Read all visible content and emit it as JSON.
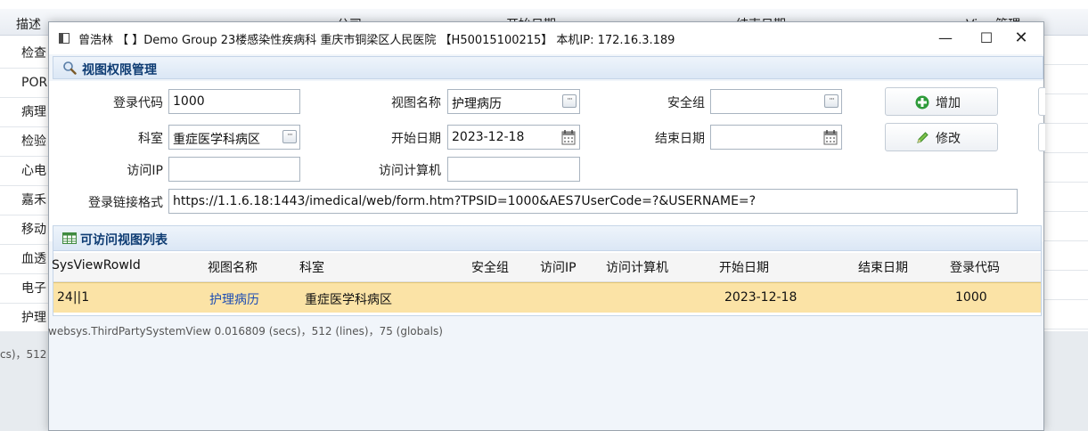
{
  "background": {
    "header_columns": [
      "描述",
      "公司",
      "开始日期",
      "结束日期",
      "View管理"
    ],
    "rows": [
      "检查",
      "POR",
      "病理",
      "检验",
      "心电",
      "嘉禾",
      "移动",
      "血透",
      "电子",
      "护理"
    ],
    "status_left": "cs)，512",
    "status_text": "websys.ThirdPartySystemView   0.016809 (secs)，512 (lines)，75 (globals)"
  },
  "window": {
    "title": "曾浩林 【 】Demo Group 23楼感染性疾病科 重庆市铜梁区人民医院 【H50015100215】 本机IP: 172.16.3.189",
    "controls": {
      "minimize": "—",
      "maximize": "☐",
      "close": "✕"
    }
  },
  "panel": {
    "title": "视图权限管理",
    "icon": "search-icon"
  },
  "form": {
    "login_code": {
      "label": "登录代码",
      "value": "1000"
    },
    "view_name": {
      "label": "视图名称",
      "value": "护理病历"
    },
    "security_group": {
      "label": "安全组",
      "value": ""
    },
    "department": {
      "label": "科室",
      "value": "重症医学科病区"
    },
    "start_date": {
      "label": "开始日期",
      "value": "2023-12-18"
    },
    "end_date": {
      "label": "结束日期",
      "value": ""
    },
    "access_ip": {
      "label": "访问IP",
      "value": ""
    },
    "access_computer": {
      "label": "访问计算机",
      "value": ""
    },
    "login_url_format": {
      "label": "登录链接格式",
      "value": "https://1.1.6.18:1443/imedical/web/form.htm?TPSID=1000&AES7UserCode=?&USERNAME=?"
    },
    "lookup_glyph": "···",
    "buttons": {
      "add": "增加",
      "edit": "修改"
    }
  },
  "table": {
    "title": "可访问视图列表",
    "columns": [
      "SysViewRowId",
      "视图名称",
      "科室",
      "安全组",
      "访问IP",
      "访问计算机",
      "开始日期",
      "结束日期",
      "登录代码"
    ],
    "rows": [
      {
        "SysViewRowId": "24||1",
        "view_name": "护理病历",
        "department": "重症医学科病区",
        "security_group": "",
        "access_ip": "",
        "access_computer": "",
        "start_date": "2023-12-18",
        "end_date": "",
        "login_code": "1000"
      }
    ]
  },
  "colors": {
    "panel_title": "#0e3c73",
    "selected_row": "#fbe3a6",
    "link": "#1d4db3",
    "add_icon": "#2e9b3a",
    "edit_icon": "#3a8a2a"
  }
}
